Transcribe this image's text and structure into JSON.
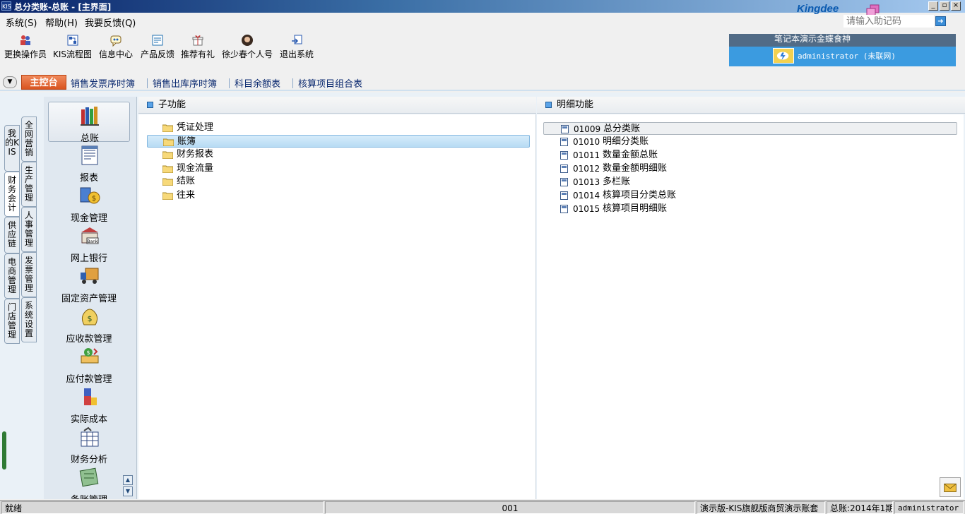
{
  "window": {
    "title": "总分类账-总账 - [主界面]",
    "app_icon_text": "KIS"
  },
  "menu": {
    "items": [
      "系统(S)",
      "帮助(H)",
      "我要反馈(Q)"
    ]
  },
  "brand": {
    "logo_text": "Kingdee",
    "help_code_placeholder": "请输入助记码"
  },
  "toolbar": {
    "items": [
      {
        "label": "更换操作员",
        "icon": "users-icon"
      },
      {
        "label": "KIS流程图",
        "icon": "flowchart-icon"
      },
      {
        "label": "信息中心",
        "icon": "message-icon"
      },
      {
        "label": "产品反馈",
        "icon": "feedback-icon"
      },
      {
        "label": "推荐有礼",
        "icon": "gift-icon"
      },
      {
        "label": "徐少春个人号",
        "icon": "avatar-icon"
      },
      {
        "label": "退出系统",
        "icon": "exit-icon"
      }
    ]
  },
  "user_panel": {
    "company": "笔记本演示金蝶食神",
    "user": "administrator (未联网)"
  },
  "tabs": {
    "home": "主控台",
    "items": [
      "销售发票序时簿",
      "销售出库序时簿",
      "科目余额表",
      "核算项目组合表"
    ]
  },
  "vertical_tabs": {
    "col1": [
      "我的KIS",
      "财务会计",
      "供应链",
      "电商管理",
      "门店管理"
    ],
    "col2": [
      "全网营销",
      "生产管理",
      "人事管理",
      "发票管理",
      "系统设置"
    ]
  },
  "modules": [
    "总账",
    "报表",
    "现金管理",
    "网上银行",
    "固定资产管理",
    "应收款管理",
    "应付款管理",
    "实际成本",
    "财务分析",
    "条账管理"
  ],
  "sub_panel": {
    "title": "子功能",
    "items": [
      "凭证处理",
      "账簿",
      "财务报表",
      "现金流量",
      "结账",
      "往来"
    ]
  },
  "detail_panel": {
    "title": "明细功能",
    "items": [
      {
        "code": "01009",
        "name": "总分类账"
      },
      {
        "code": "01010",
        "name": "明细分类账"
      },
      {
        "code": "01011",
        "name": "数量金额总账"
      },
      {
        "code": "01012",
        "name": "数量金额明细账"
      },
      {
        "code": "01013",
        "name": "多栏账"
      },
      {
        "code": "01014",
        "name": "核算项目分类总账"
      },
      {
        "code": "01015",
        "name": "核算项目明细账"
      }
    ]
  },
  "status": {
    "ready": "就绪",
    "code": "001",
    "edition": "演示版-KIS旗舰版商贸演示账套",
    "period": "总账:2014年1期",
    "user": "administrator"
  },
  "colors": {
    "title_bar": "#0a246a",
    "accent_tab": "#d9541f",
    "user_panel": "#3b9be0",
    "selection": "#b7dcf4"
  }
}
